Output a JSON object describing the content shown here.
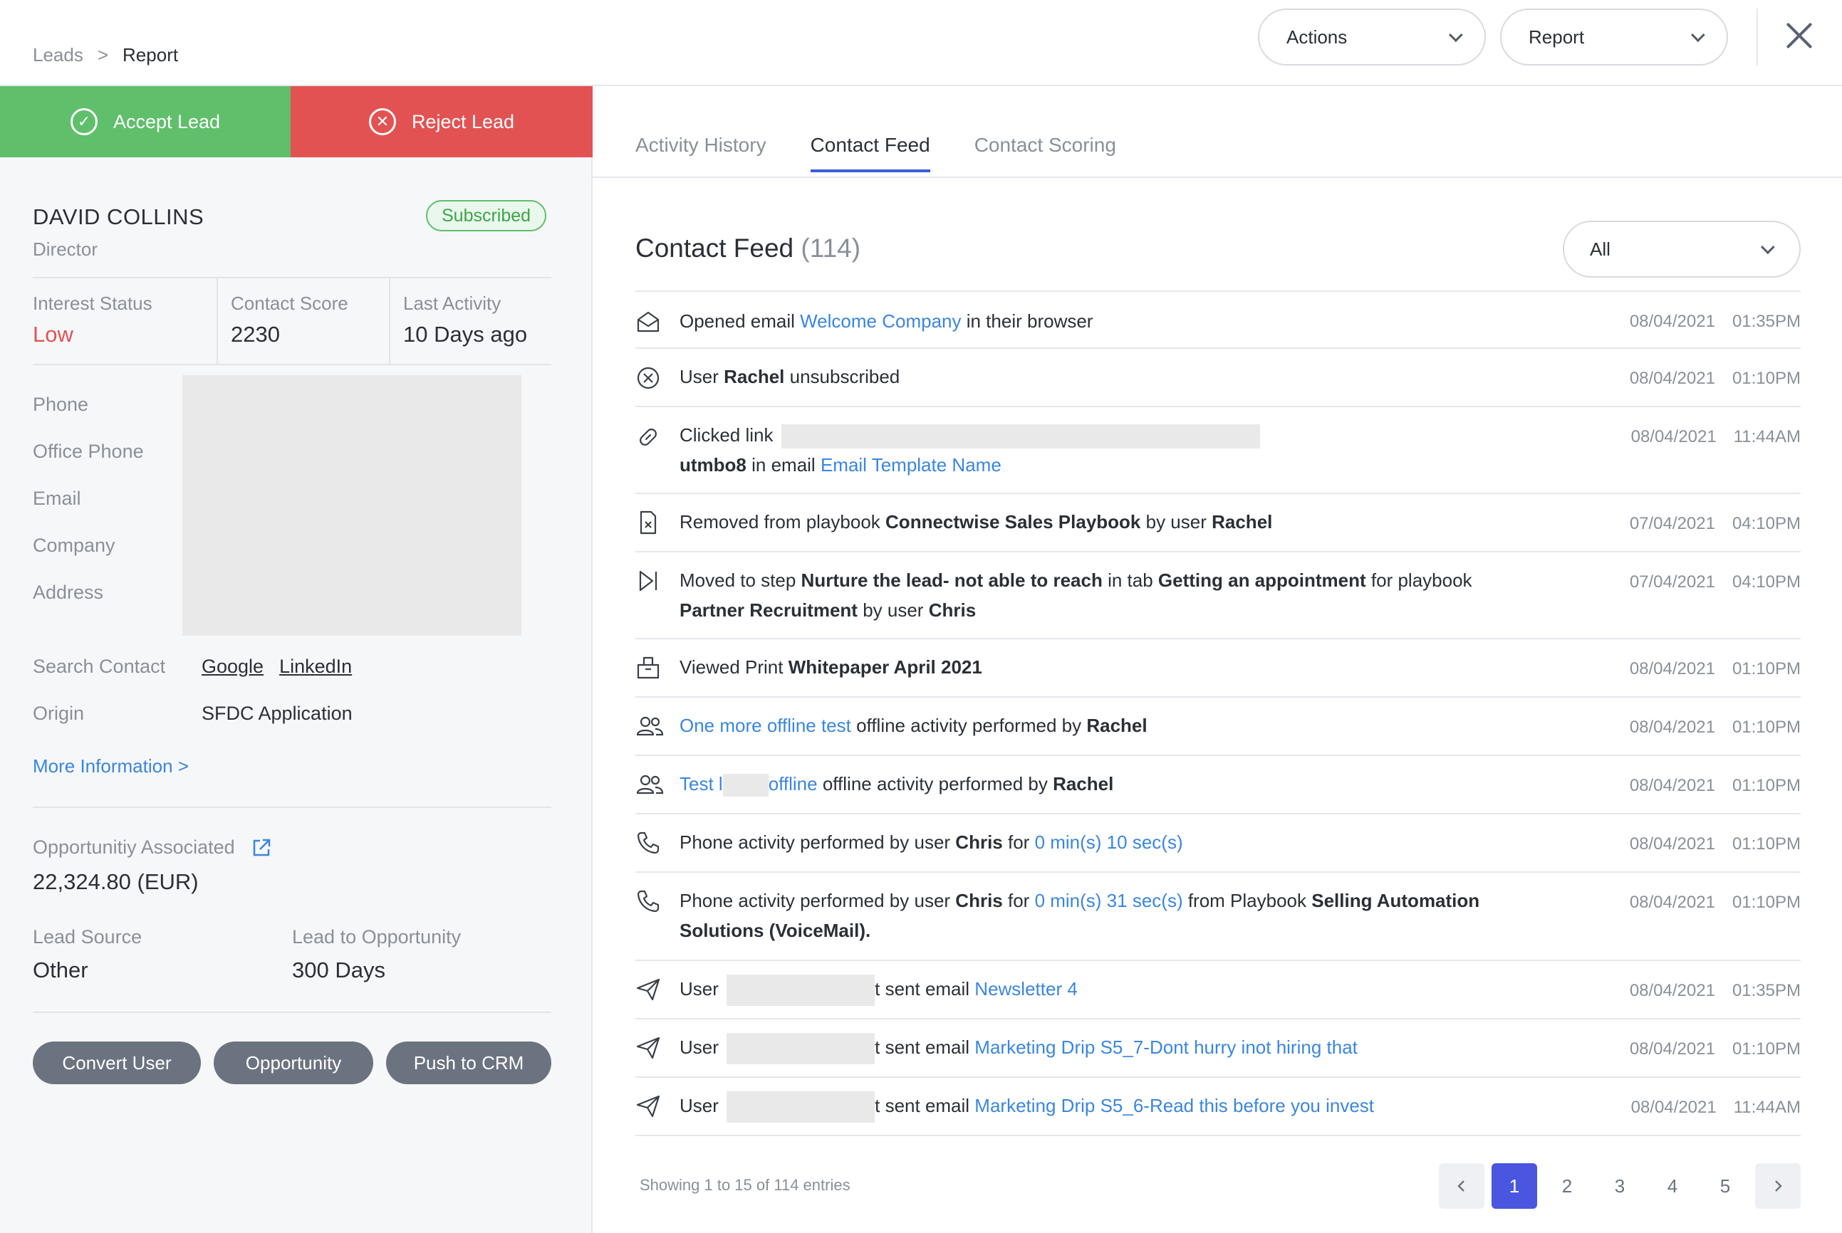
{
  "breadcrumb": {
    "root": "Leads",
    "sep": ">",
    "current": "Report"
  },
  "header": {
    "actions_label": "Actions",
    "report_label": "Report"
  },
  "lead_actions": {
    "accept": "Accept Lead",
    "reject": "Reject Lead"
  },
  "lead": {
    "name": "DAVID COLLINS",
    "title": "Director",
    "status_badge": "Subscribed",
    "stats": [
      {
        "label": "Interest Status",
        "value": "Low"
      },
      {
        "label": "Contact Score",
        "value": "2230"
      },
      {
        "label": "Last Activity",
        "value": "10 Days ago"
      }
    ],
    "contact_fields": [
      "Phone",
      "Office Phone",
      "Email",
      "Company",
      "Address"
    ],
    "search_contact": {
      "label": "Search Contact",
      "google": "Google",
      "linkedin": "LinkedIn"
    },
    "origin": {
      "label": "Origin",
      "value": "SFDC Application"
    },
    "more_info": "More Information >",
    "opportunity": {
      "label": "Opportunitiy Associated",
      "value": "22,324.80 (EUR)"
    },
    "lead_source": {
      "label": "Lead Source",
      "value": "Other"
    },
    "lead_to_opp": {
      "label": "Lead to Opportunity",
      "value": "300 Days"
    },
    "buttons": {
      "convert": "Convert User",
      "opportunity": "Opportunity",
      "push": "Push to CRM"
    }
  },
  "tabs": [
    "Activity History",
    "Contact Feed",
    "Contact Scoring"
  ],
  "feed": {
    "title": "Contact Feed",
    "count": "(114)",
    "filter": "All",
    "rows": [
      {
        "icon": "envelope-open-icon",
        "date": "08/04/2021",
        "time": "01:35PM",
        "parts": {
          "a": "Opened email ",
          "b": "Welcome Company",
          "c": " in their browser"
        }
      },
      {
        "icon": "unsubscribe-icon",
        "date": "08/04/2021",
        "time": "01:10PM",
        "parts": {
          "a": "User ",
          "b": "Rachel",
          "c": " unsubscribed"
        }
      },
      {
        "icon": "link-icon",
        "date": "08/04/2021",
        "time": "11:44AM",
        "parts": {
          "a": "Clicked link ",
          "b": "utmbo8",
          "c": " in email ",
          "d": "Email Template Name"
        }
      },
      {
        "icon": "document-remove-icon",
        "date": "07/04/2021",
        "time": "04:10PM",
        "parts": {
          "a": "Removed from playbook ",
          "b": "Connectwise Sales Playbook",
          "c": " by user ",
          "d": "Rachel"
        }
      },
      {
        "icon": "skip-step-icon",
        "date": "07/04/2021",
        "time": "04:10PM",
        "parts": {
          "a": "Moved to step ",
          "b": "Nurture the lead- not able to reach",
          "c": " in tab ",
          "d": "Getting an appointment",
          "e": " for playbook ",
          "f": "Partner Recruitment",
          "g": " by user ",
          "h": "Chris"
        }
      },
      {
        "icon": "whitepaper-icon",
        "date": "08/04/2021",
        "time": "01:10PM",
        "parts": {
          "a": "Viewed Print ",
          "b": "Whitepaper April 2021"
        }
      },
      {
        "icon": "users-icon",
        "date": "08/04/2021",
        "time": "01:10PM",
        "parts": {
          "a": "One more offline test",
          "b": " offline activity performed by ",
          "c": "Rachel"
        }
      },
      {
        "icon": "users-icon",
        "date": "08/04/2021",
        "time": "01:10PM",
        "parts": {
          "a": "Test l",
          "b": "offline",
          "c": " offline activity performed by ",
          "d": "Rachel"
        }
      },
      {
        "icon": "phone-icon",
        "date": "08/04/2021",
        "time": "01:10PM",
        "parts": {
          "a": "Phone activity performed by user ",
          "b": "Chris",
          "c": " for ",
          "d": "0 min(s) 10 sec(s)"
        }
      },
      {
        "icon": "phone-icon",
        "date": "08/04/2021",
        "time": "01:10PM",
        "parts": {
          "a": "Phone activity performed by user ",
          "b": "Chris",
          "c": " for ",
          "d": "0 min(s) 31 sec(s)",
          "e": " from Playbook ",
          "f": "Selling Automation Solutions (VoiceMail)."
        }
      },
      {
        "icon": "send-icon",
        "date": "08/04/2021",
        "time": "01:35PM",
        "parts": {
          "a": "User ",
          "b": "t sent email ",
          "c": "Newsletter 4"
        }
      },
      {
        "icon": "send-icon",
        "date": "08/04/2021",
        "time": "01:10PM",
        "parts": {
          "a": "User ",
          "b": "t sent email ",
          "c": "Marketing Drip S5_7-Dont hurry inot hiring that"
        }
      },
      {
        "icon": "send-icon",
        "date": "08/04/2021",
        "time": "11:44AM",
        "parts": {
          "a": "User ",
          "b": "t sent email ",
          "c": "Marketing Drip S5_6-Read this before you invest"
        }
      }
    ]
  },
  "pagination": {
    "showing": "Showing 1 to 15 of 114 entries",
    "prev": "<",
    "pages": [
      "1",
      "2",
      "3",
      "4",
      "5"
    ],
    "next": ">",
    "active": "1"
  },
  "colors": {
    "accept": "#5fbf6b",
    "reject": "#e35252",
    "link": "#3a86e0",
    "active_page": "#4a56e0"
  }
}
